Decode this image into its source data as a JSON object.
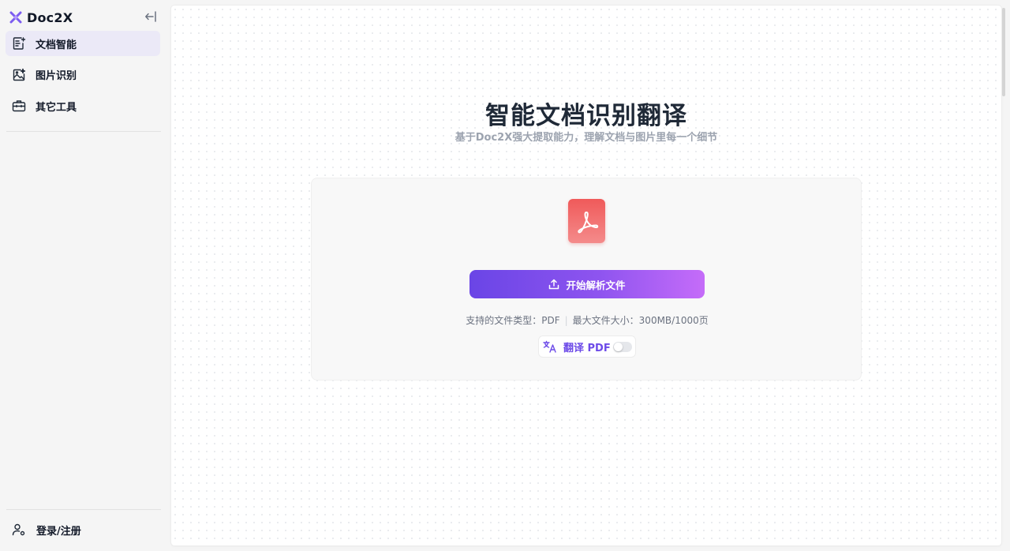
{
  "sidebar": {
    "brand": {
      "name": "Doc2X"
    },
    "collapse_icon": "collapse-left-icon",
    "items": [
      {
        "label": "文档智能",
        "icon": "document-edit-icon",
        "active": true
      },
      {
        "label": "图片识别",
        "icon": "image-sparkle-icon",
        "active": false
      },
      {
        "label": "其它工具",
        "icon": "toolbox-icon",
        "active": false
      }
    ],
    "login": {
      "label": "登录/注册",
      "icon": "user-settings-icon"
    }
  },
  "main": {
    "title": "智能文档识别翻译",
    "subtitle": "基于Doc2X强大提取能力，理解文档与图片里每一个细节",
    "upload": {
      "file_icon": "pdf-icon",
      "button_label": "开始解析文件",
      "button_icon": "upload-icon",
      "supported_types": "支持的文件类型：PDF",
      "max_size": "最大文件大小：300MB/1000页",
      "translate_label": "翻译 PDF",
      "translate_icon": "translate-icon",
      "translate_enabled": false
    }
  },
  "colors": {
    "accent": "#6d4be8",
    "button_gradient_start": "#6a45e6",
    "button_gradient_end": "#c56cf9",
    "active_nav_bg": "#ebe9f7",
    "pdf_red": "#f05a5a"
  }
}
